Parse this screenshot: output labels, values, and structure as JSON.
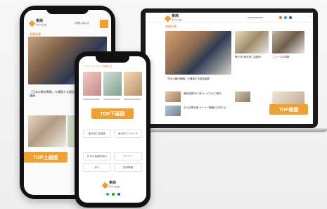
{
  "brand": {
    "name_line1": "東商",
    "name_line2": "ドットコム",
    "accent": "#f0a030"
  },
  "badges": {
    "top_upper": "TOP上画面",
    "top_lower": "TOP下画面",
    "top_laptop": "TOP画面"
  },
  "mid_phone": {
    "section": "アンケートについてのお知らせ",
    "ad_items": [
      "東京商工会議所",
      "東京商工リサーチ",
      "日本の会議所協力",
      "セミナー",
      "求人",
      "採用情報"
    ]
  },
  "laptop": {
    "headline": "「日本の観光戦略」を講演する国会議員",
    "side1": "第47回 東京商工会議所",
    "side2": "ニュースの特集",
    "list1": "東商会員向け 新サービスのご案内",
    "list2": "中小企業支援 セミナー開催のお知らせ"
  },
  "left_phone": {
    "nav": "お問い合わせ",
    "section": "新着記事",
    "headline": "「日本の観光戦略」を講演する国会議員"
  }
}
